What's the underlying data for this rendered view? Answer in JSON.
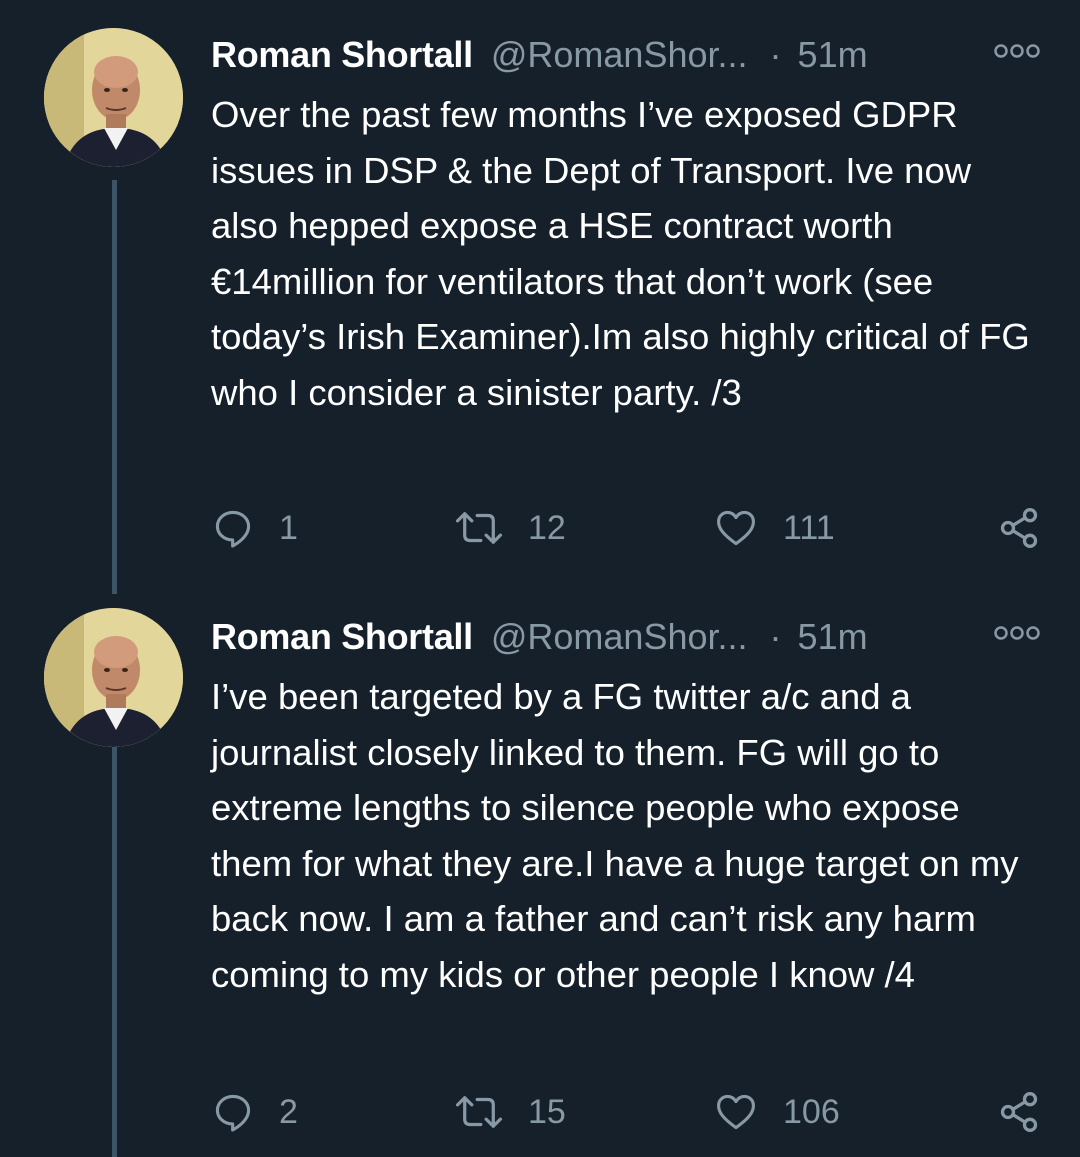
{
  "tweets": [
    {
      "author_name": "Roman Shortall",
      "handle": "@RomanShor...",
      "separator": "·",
      "time": "51m",
      "text": "Over the past few months I’ve exposed GDPR issues in DSP & the Dept of Transport. Ive now also hepped expose a HSE contract worth €14million for ventilators that don’t work (see today’s Irish Examiner).Im also highly critical of FG who I consider a sinister party. /3",
      "replies": "1",
      "retweets": "12",
      "likes": "111"
    },
    {
      "author_name": "Roman Shortall",
      "handle": "@RomanShor...",
      "separator": "·",
      "time": "51m",
      "text": "I’ve been targeted by a FG twitter a/c and a journalist closely linked to them. FG will go to extreme lengths to silence people who expose them for what they are.I have a huge target on my back now. I am a father and can’t risk any harm coming to my kids or other people I know /4",
      "replies": "2",
      "retweets": "15",
      "likes": "106"
    }
  ],
  "colors": {
    "background": "#15202b",
    "text_primary": "#ffffff",
    "text_secondary": "#8899a6",
    "thread_line": "#3d5466"
  },
  "icons": {
    "more": "more-options-icon",
    "reply": "reply-icon",
    "retweet": "retweet-icon",
    "like": "heart-icon",
    "share": "share-icon"
  }
}
